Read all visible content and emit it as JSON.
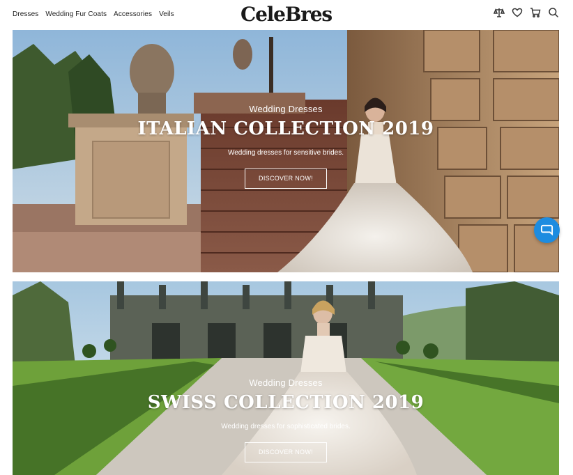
{
  "header": {
    "nav": [
      "Dresses",
      "Wedding Fur Coats",
      "Accessories",
      "Veils"
    ],
    "logo": "CeleBres",
    "icons": [
      "compare-scale-icon",
      "heart-icon",
      "cart-icon",
      "search-icon"
    ]
  },
  "banners": [
    {
      "kicker": "Wedding Dresses",
      "title": "ITALIAN COLLECTION 2019",
      "subtitle": "Wedding dresses for sensitive brides.",
      "button": "DISCOVER NOW!"
    },
    {
      "kicker": "Wedding Dresses",
      "title": "SWISS COLLECTION 2019",
      "subtitle": "Wedding dresses for sophisticated brides.",
      "button": "DISCOVER NOW!"
    }
  ],
  "chat": {
    "icon": "chat-bubble-icon",
    "color": "#1d8ce0"
  }
}
